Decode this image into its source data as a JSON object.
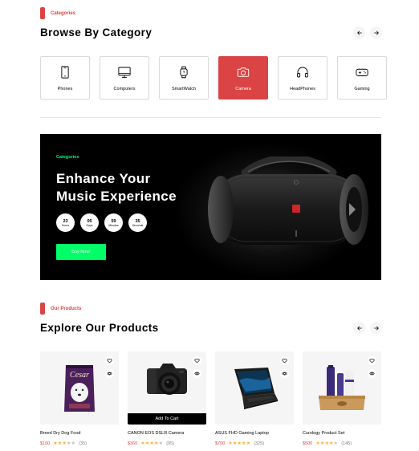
{
  "categories_section": {
    "tag": "Categories",
    "title": "Browse By Category",
    "items": [
      {
        "label": "Phones",
        "icon": "phone-icon",
        "active": false
      },
      {
        "label": "Computers",
        "icon": "computer-icon",
        "active": false
      },
      {
        "label": "SmartWatch",
        "icon": "smartwatch-icon",
        "active": false
      },
      {
        "label": "Camera",
        "icon": "camera-icon",
        "active": true
      },
      {
        "label": "HeadPhones",
        "icon": "headphones-icon",
        "active": false
      },
      {
        "label": "Gaming",
        "icon": "gamepad-icon",
        "active": false
      }
    ]
  },
  "banner": {
    "tag": "Categories",
    "title_line1": "Enhance Your",
    "title_line2": "Music Experience",
    "countdown": [
      {
        "value": "23",
        "label": "Hours"
      },
      {
        "value": "05",
        "label": "Days"
      },
      {
        "value": "59",
        "label": "Minutes"
      },
      {
        "value": "35",
        "label": "Seconds"
      }
    ],
    "button": "Buy Now!"
  },
  "products_section": {
    "tag": "Our Products",
    "title": "Explore Our Products",
    "add_to_cart": "Add To Cart",
    "items": [
      {
        "name": "Breed Dry Dog Food",
        "price": "$100",
        "rating": 3,
        "reviews": "(35)"
      },
      {
        "name": "CANON EOS DSLR Camera",
        "price": "$360",
        "rating": 4,
        "reviews": "(95)"
      },
      {
        "name": "ASUS FHD Gaming Laptop",
        "price": "$700",
        "rating": 5,
        "reviews": "(325)"
      },
      {
        "name": "Curology Product Set",
        "price": "$500",
        "rating": 4,
        "reviews": "(145)"
      }
    ]
  },
  "colors": {
    "accent": "#DB4444",
    "green": "#00FF66",
    "star": "#FFAD33"
  }
}
